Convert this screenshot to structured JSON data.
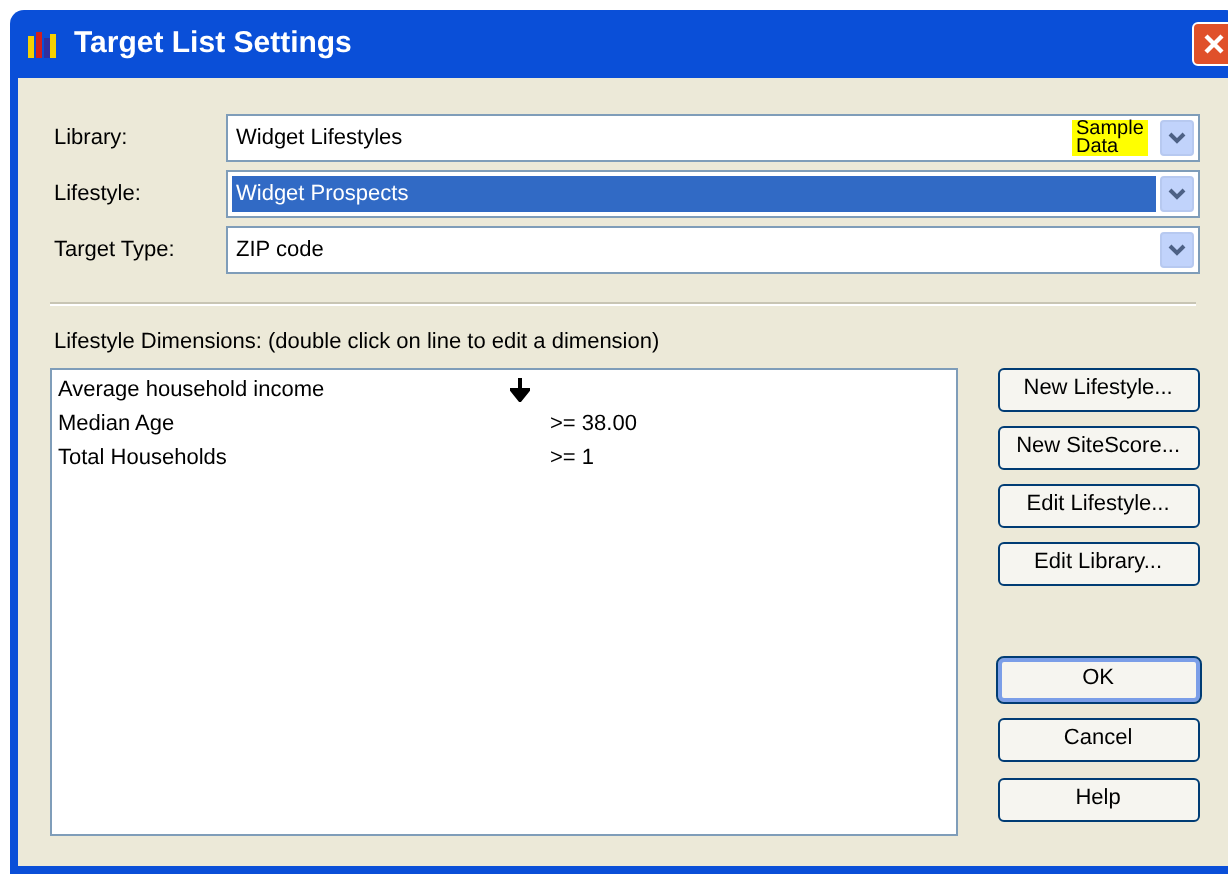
{
  "window": {
    "title": "Target List Settings"
  },
  "fields": [
    {
      "label": "Library:",
      "value": "Widget Lifestyles",
      "badge": "Sample Data",
      "selected": false
    },
    {
      "label": "Lifestyle:",
      "value": "Widget Prospects",
      "selected": true
    },
    {
      "label": "Target Type:",
      "value": "ZIP code",
      "selected": false
    }
  ],
  "dimensions": {
    "label": "Lifestyle Dimensions: (double click on line to edit a dimension)",
    "rows": [
      {
        "name": "Average household income",
        "sorted": true
      },
      {
        "name": "Median Age",
        "value": ">= 38.00",
        "sorted": false
      },
      {
        "name": "Total Households",
        "value": ">= 1",
        "sorted": false
      }
    ]
  },
  "side_buttons": [
    {
      "label": "New Lifestyle...",
      "default": false
    },
    {
      "label": "New SiteScore...",
      "default": false
    },
    {
      "label": "Edit Lifestyle...",
      "default": false
    },
    {
      "label": "Edit Library...",
      "default": false
    }
  ],
  "dialog_buttons": [
    {
      "label": "OK",
      "default": true
    },
    {
      "label": "Cancel",
      "default": false
    },
    {
      "label": "Help",
      "default": false
    }
  ]
}
